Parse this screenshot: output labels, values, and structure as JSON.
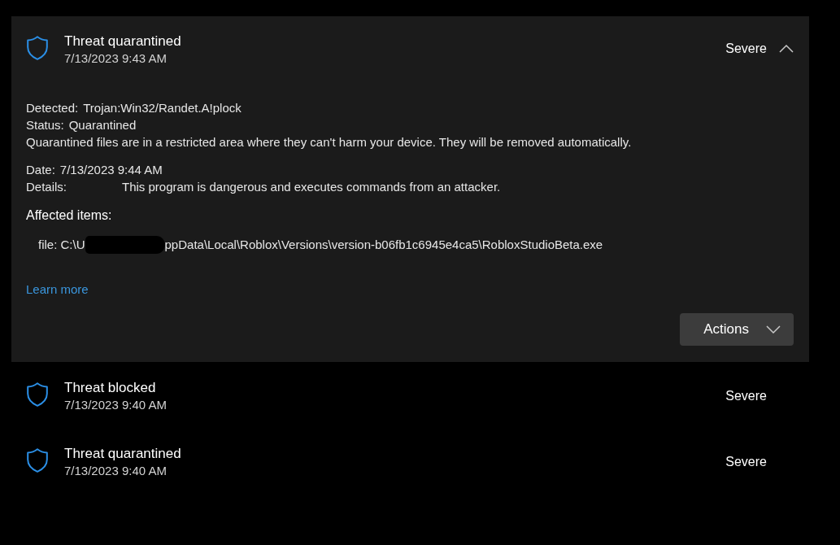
{
  "threats": [
    {
      "title": "Threat quarantined",
      "time": "7/13/2023 9:43 AM",
      "severity": "Severe",
      "expanded": true,
      "details": {
        "groups": [
          [
            {
              "kind": "field",
              "label": "Detected:",
              "value": "Trojan:Win32/Randet.A!plock"
            },
            {
              "kind": "field",
              "label": "Status:",
              "value": "Quarantined"
            },
            {
              "kind": "note",
              "text": "Quarantined files are in a restricted area where they can't harm your device. They will be removed automatically."
            }
          ],
          [
            {
              "kind": "field",
              "label": "Date:",
              "value": "7/13/2023 9:44 AM"
            },
            {
              "kind": "tabbed",
              "label": "Details:",
              "value": "This program is dangerous and executes commands from an attacker."
            }
          ]
        ],
        "affected_heading": "Affected items:",
        "affected_items": [
          {
            "start": "file: C:\\U",
            "redacted": true,
            "end": "ppData\\Local\\Roblox\\Versions\\version-b06fb1c6945e4ca5\\RobloxStudioBeta.exe"
          }
        ],
        "link": "Learn more",
        "actions_button": "Actions"
      }
    },
    {
      "title": "Threat blocked",
      "time": "7/13/2023 9:40 AM",
      "severity": "Severe",
      "expanded": false
    },
    {
      "title": "Threat quarantined",
      "time": "7/13/2023 9:40 AM",
      "severity": "Severe",
      "expanded": false
    }
  ]
}
